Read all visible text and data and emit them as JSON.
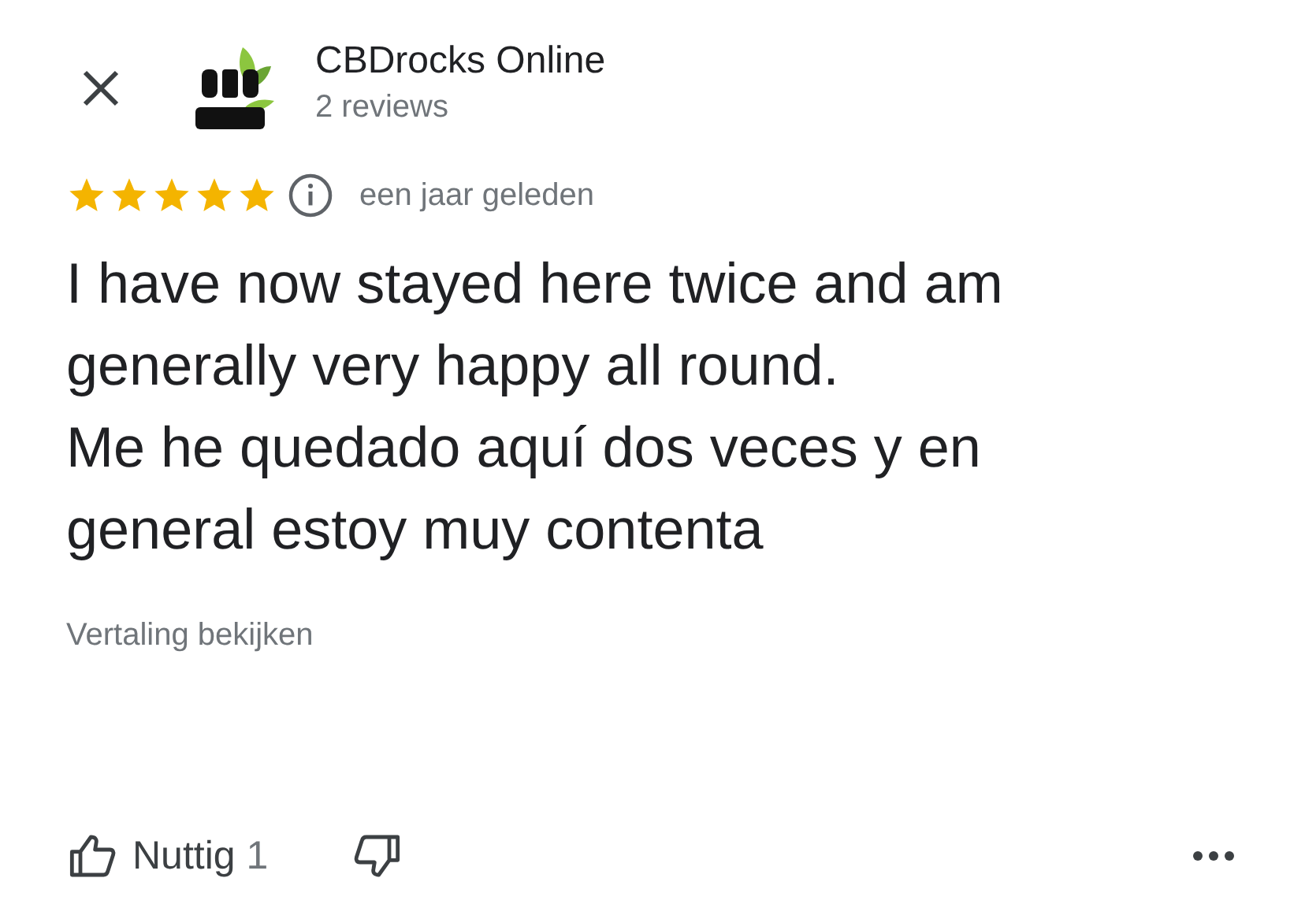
{
  "business": {
    "name": "CBDrocks Online",
    "reviews": "2 reviews"
  },
  "review": {
    "stars": 5,
    "time": "een jaar geleden",
    "paragraphs": [
      "I have now stayed here twice and am generally very happy all round.",
      "Me he quedado aquí dos veces y en general estoy muy contenta"
    ],
    "translate_link": "Vertaling bekijken"
  },
  "actions": {
    "helpful_label": "Nuttig",
    "helpful_count": "1"
  }
}
